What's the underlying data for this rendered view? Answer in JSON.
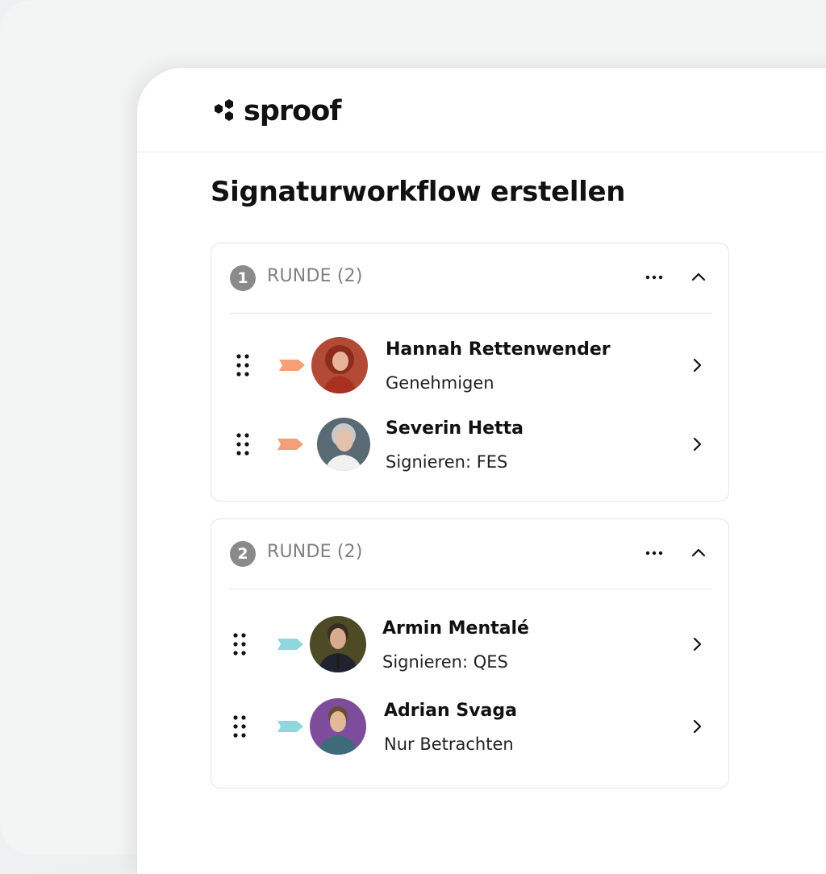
{
  "brand": {
    "name": "sproof",
    "logo_icon": "hexagon-cluster-icon"
  },
  "page": {
    "title": "Signaturworkflow erstellen"
  },
  "colors": {
    "orange_tag": "#f59f78",
    "cyan_tag": "#8fd6df",
    "round_badge": "#8a8a8a"
  },
  "rounds": [
    {
      "number": "1",
      "label": "RUNDE (2)",
      "signers": [
        {
          "name": "Hannah Rettenwender",
          "role": "Genehmigen",
          "tag_color": "#f59f78"
        },
        {
          "name": "Severin Hetta",
          "role": "Signieren: FES",
          "tag_color": "#f59f78"
        }
      ]
    },
    {
      "number": "2",
      "label": "RUNDE (2)",
      "signers": [
        {
          "name": "Armin Mentalé",
          "role": "Signieren: QES",
          "tag_color": "#8fd6df"
        },
        {
          "name": "Adrian Svaga",
          "role": "Nur Betrachten",
          "tag_color": "#8fd6df"
        }
      ]
    }
  ]
}
